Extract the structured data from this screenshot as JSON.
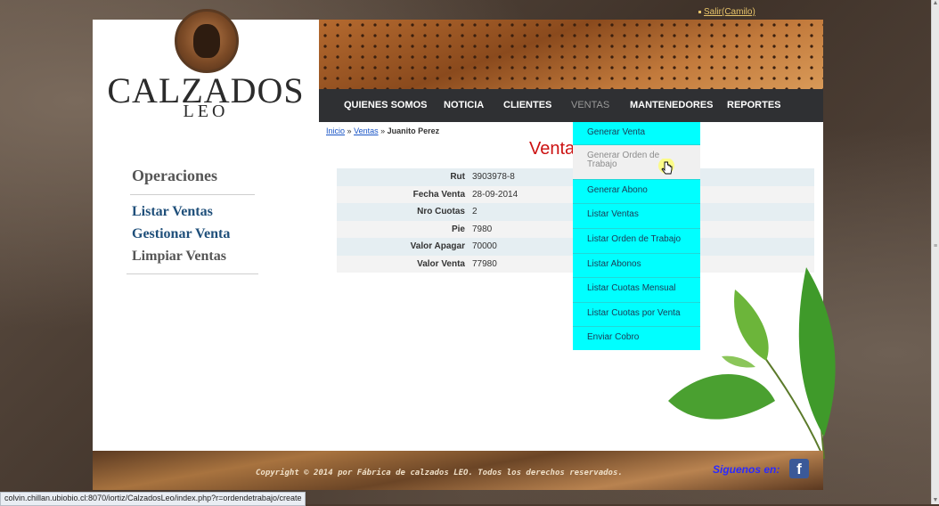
{
  "header": {
    "logout_label": "Salir(Camilo)",
    "brand_main": "CALZADOS",
    "brand_sub": "LEO"
  },
  "nav": {
    "items": [
      "QUIENES SOMOS",
      "NOTICIA",
      "CLIENTES",
      "VENTAS",
      "MANTENEDORES",
      "REPORTES"
    ],
    "active": "VENTAS"
  },
  "breadcrumb": {
    "home": "Inicio",
    "sep1": "»",
    "section": "Ventas",
    "sep2": "»",
    "current": "Juanito Perez"
  },
  "main": {
    "title": "Venta",
    "rows": [
      {
        "label": "Rut",
        "value": "3903978-8"
      },
      {
        "label": "Fecha Venta",
        "value": "28-09-2014"
      },
      {
        "label": "Nro Cuotas",
        "value": "2"
      },
      {
        "label": "Pie",
        "value": "7980"
      },
      {
        "label": "Valor Apagar",
        "value": "70000"
      },
      {
        "label": "Valor Venta",
        "value": "77980"
      }
    ]
  },
  "sidebar": {
    "heading": "Operaciones",
    "links": [
      {
        "label": "Listar Ventas",
        "color": "#1f4f7a"
      },
      {
        "label": "Gestionar Venta",
        "color": "#1f4f7a"
      },
      {
        "label": "Limpiar Ventas",
        "color": "#555555"
      }
    ]
  },
  "dropdown": {
    "items": [
      "Generar Venta",
      "Generar Orden de Trabajo",
      "Generar Abono",
      "Listar Ventas",
      "Listar Orden de Trabajo",
      "Listar Abonos",
      "Listar Cuotas Mensual",
      "Listar Cuotas por Venta",
      "Enviar Cobro"
    ],
    "hovered": "Generar Orden de Trabajo",
    "bg_color": "#00ffff"
  },
  "footer": {
    "copyright": "Copyright © 2014 por Fábrica de calzados LEO. Todos los derechos reservados.",
    "follow_label": "Siguenos en:",
    "facebook_glyph": "f"
  },
  "status_bar": {
    "url": "colvin.chillan.ubiobio.cl:8070/iortiz/CalzadosLeo/index.php?r=ordendetrabajo/create"
  },
  "colors": {
    "nav_bg": "#2f3033",
    "title_red": "#cc1111",
    "link_blue": "#1a55c6"
  }
}
